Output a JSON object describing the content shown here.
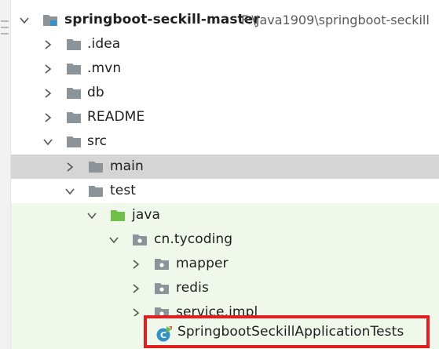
{
  "colors": {
    "folder_gray": "#8d9499",
    "folder_green": "#6fbf4a",
    "selected_bg": "#d5d5d5",
    "test_bg": "#eff8ea",
    "highlight": "#e02020",
    "module_blue": "#3592c4"
  },
  "tree": {
    "root": {
      "name": "springboot-seckill-master",
      "path": "F:\\Java1909\\springboot-seckill",
      "icon": "module-folder-icon"
    },
    "idea": {
      "name": ".idea",
      "icon": "folder-icon"
    },
    "mvn": {
      "name": ".mvn",
      "icon": "folder-icon"
    },
    "db": {
      "name": "db",
      "icon": "folder-icon"
    },
    "readme": {
      "name": "README",
      "icon": "folder-icon"
    },
    "src": {
      "name": "src",
      "icon": "folder-icon"
    },
    "main": {
      "name": "main",
      "icon": "folder-icon"
    },
    "test": {
      "name": "test",
      "icon": "folder-icon"
    },
    "java": {
      "name": "java",
      "icon": "test-sources-folder-icon"
    },
    "package": {
      "name": "cn.tycoding",
      "icon": "package-icon"
    },
    "mapper": {
      "name": "mapper",
      "icon": "package-icon"
    },
    "redis": {
      "name": "redis",
      "icon": "package-icon"
    },
    "service": {
      "name": "service.impl",
      "icon": "package-icon"
    },
    "test_class": {
      "name": "SpringbootSeckillApplicationTests",
      "icon": "test-class-icon"
    }
  }
}
